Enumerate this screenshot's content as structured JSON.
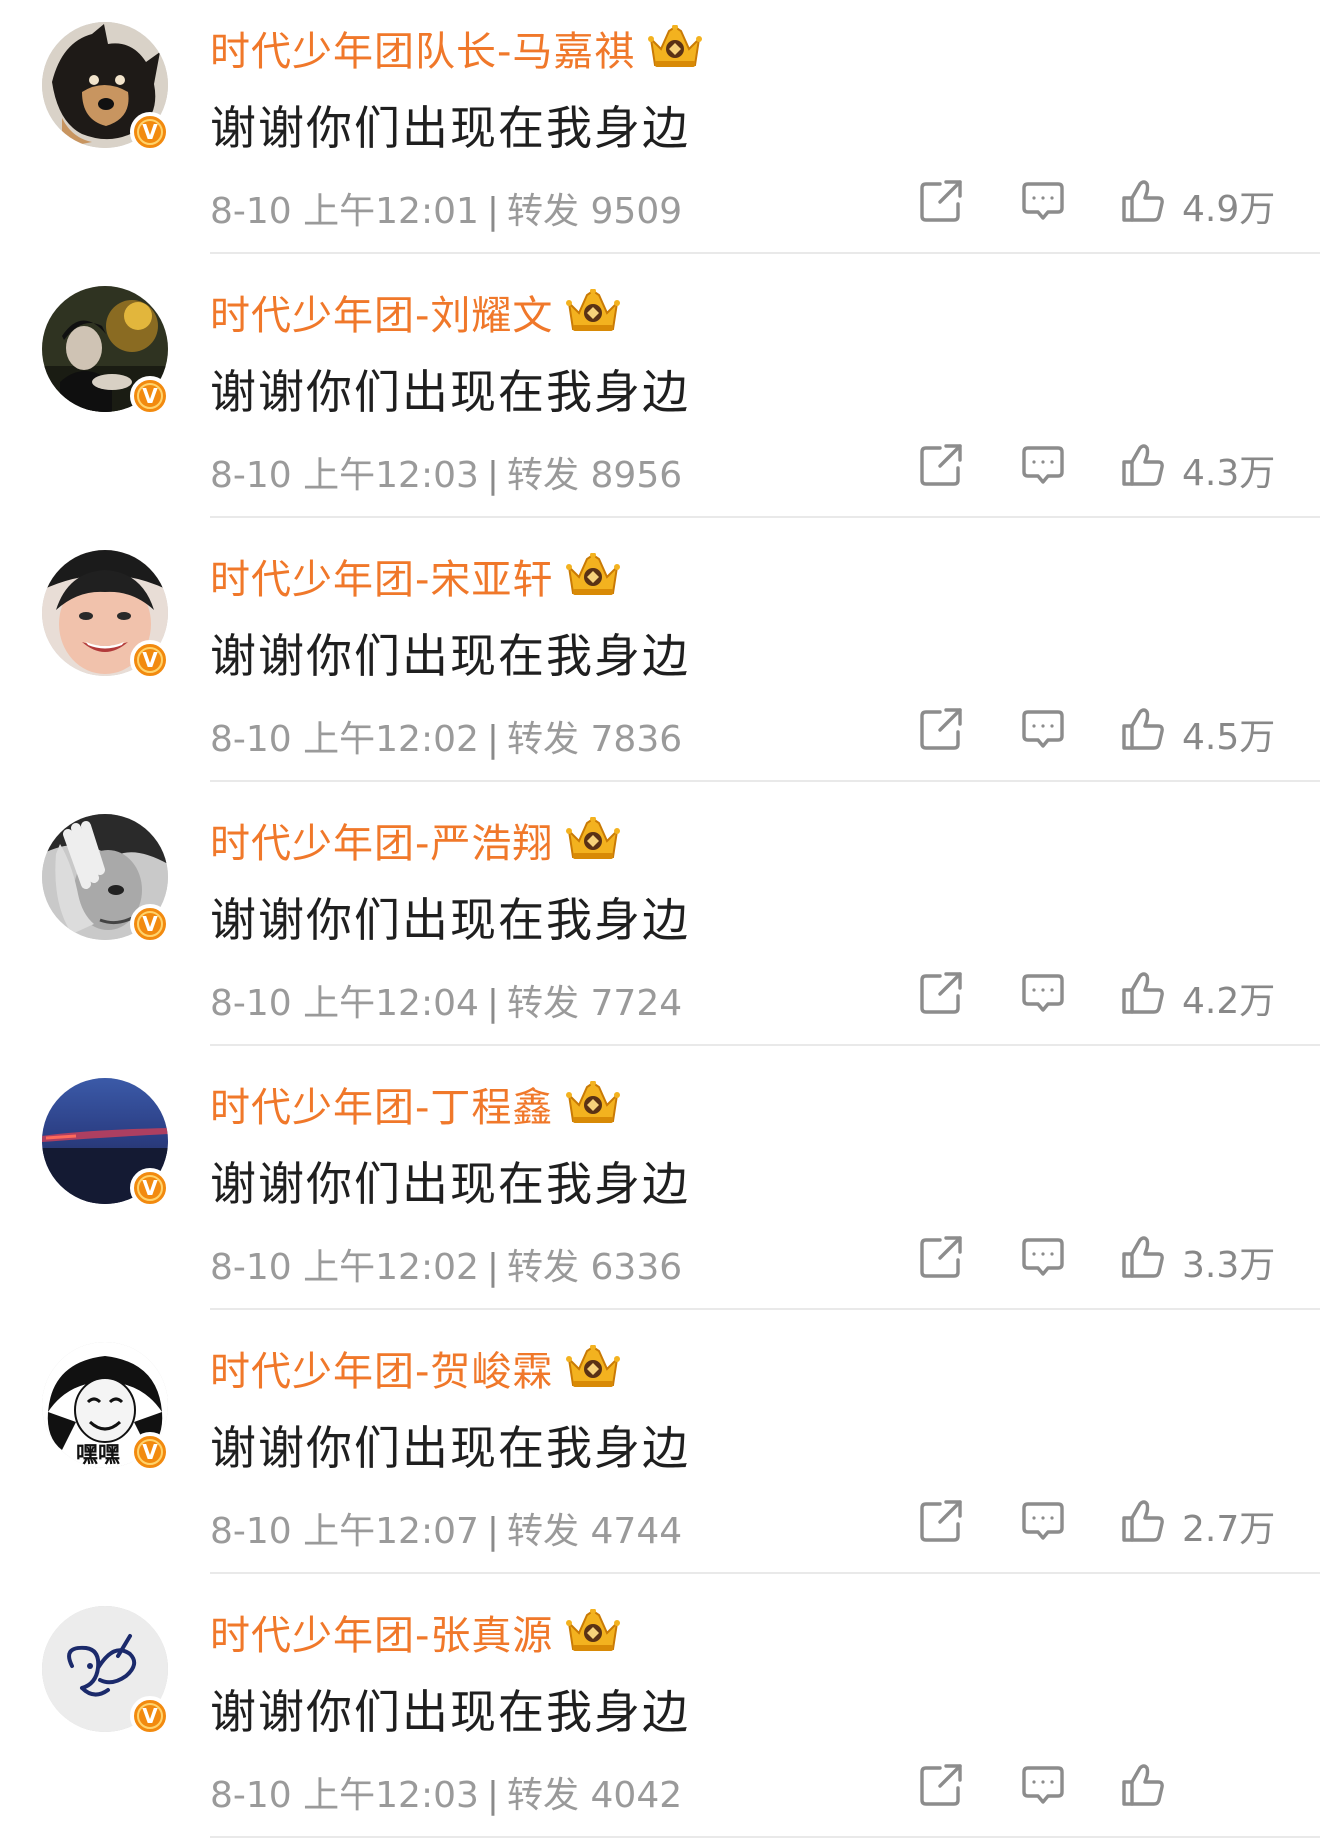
{
  "colors": {
    "username": "#f0782a",
    "badge": "#f28a0f",
    "meta": "#9a9a9a",
    "text": "#1f1f1f"
  },
  "comments": [
    {
      "username": "时代少年团队长-马嘉祺",
      "text": "谢谢你们出现在我身边",
      "date": "8-10 上午12:01",
      "repost_label": "转发",
      "repost_count": "9509",
      "likes": "4.9万",
      "avatar": "dog-photo"
    },
    {
      "username": "时代少年团-刘耀文",
      "text": "谢谢你们出现在我身边",
      "date": "8-10 上午12:03",
      "repost_label": "转发",
      "repost_count": "8956",
      "likes": "4.3万",
      "avatar": "dark-photo"
    },
    {
      "username": "时代少年团-宋亚轩",
      "text": "谢谢你们出现在我身边",
      "date": "8-10 上午12:02",
      "repost_label": "转发",
      "repost_count": "7836",
      "likes": "4.5万",
      "avatar": "face-photo"
    },
    {
      "username": "时代少年团-严浩翔",
      "text": "谢谢你们出现在我身边",
      "date": "8-10 上午12:04",
      "repost_label": "转发",
      "repost_count": "7724",
      "likes": "4.2万",
      "avatar": "bw-photo"
    },
    {
      "username": "时代少年团-丁程鑫",
      "text": "谢谢你们出现在我身边",
      "date": "8-10 上午12:02",
      "repost_label": "转发",
      "repost_count": "6336",
      "likes": "3.3万",
      "avatar": "sky-photo"
    },
    {
      "username": "时代少年团-贺峻霖",
      "text": "谢谢你们出现在我身边",
      "date": "8-10 上午12:07",
      "repost_label": "转发",
      "repost_count": "4744",
      "likes": "2.7万",
      "avatar": "meme-face",
      "avatar_caption": "嘿嘿"
    },
    {
      "username": "时代少年团-张真源",
      "text": "谢谢你们出现在我身边",
      "date": "8-10 上午12:03",
      "repost_label": "转发",
      "repost_count": "4042",
      "likes": "",
      "avatar": "doodle"
    }
  ]
}
